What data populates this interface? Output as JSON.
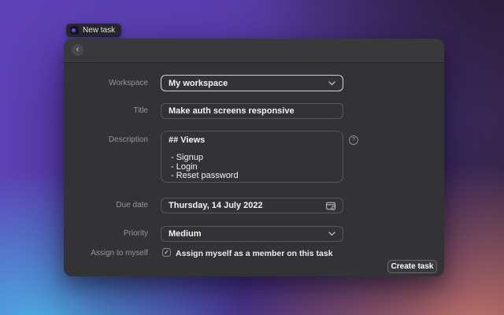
{
  "window": {
    "tab_label": "New task"
  },
  "modal": {
    "back_glyph": "‹",
    "help_glyph": "?",
    "fields": {
      "workspace": {
        "label": "Workspace",
        "value": "My workspace"
      },
      "title": {
        "label": "Title",
        "value": "Make auth screens responsive"
      },
      "description": {
        "label": "Description",
        "heading": "## Views",
        "items": "- Signup\n- Login\n- Reset password"
      },
      "due_date": {
        "label": "Due date",
        "value": "Thursday, 14 July 2022"
      },
      "priority": {
        "label": "Priority",
        "value": "Medium"
      },
      "assign_to_myself": {
        "label": "Assign to myself",
        "checked": true,
        "check_glyph": "✓",
        "checkbox_label": "Assign myself as a member on this task"
      }
    },
    "create_button_label": "Create task"
  },
  "colors": {
    "modal_background": "#333336",
    "header_background": "#39393c",
    "input_border": "#58585b",
    "focused_border": "#d2d2d4",
    "label_text": "#96969a",
    "value_text": "#f3f3f5",
    "gradient_top_left": "#5d41b6",
    "gradient_top_right": "#342443",
    "gradient_bottom_left": "#4cb9eb",
    "gradient_bottom_right": "#d27c70"
  }
}
